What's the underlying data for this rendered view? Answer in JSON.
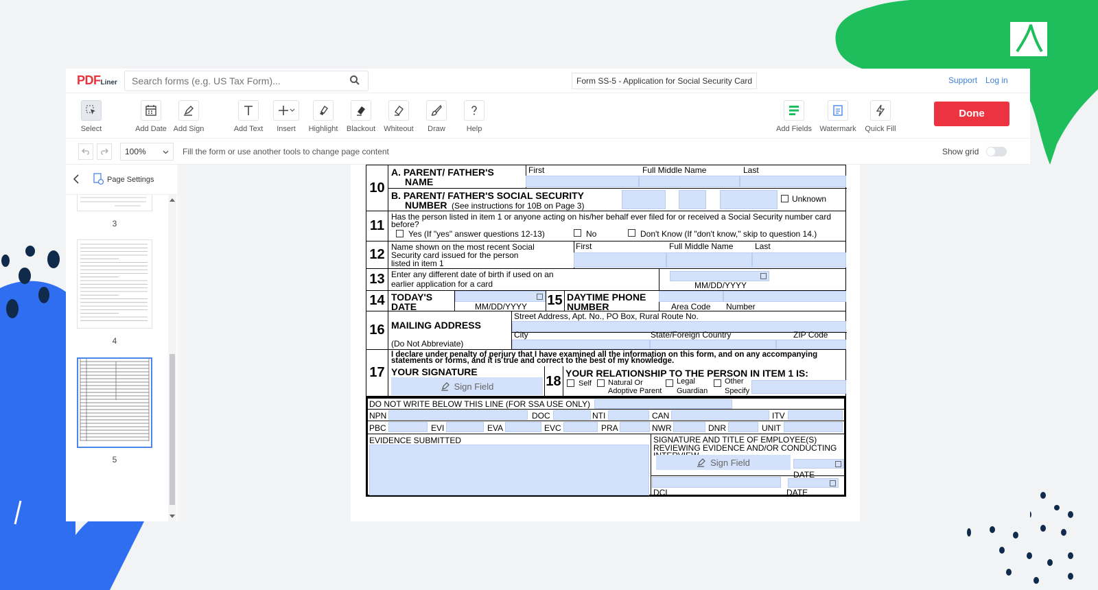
{
  "header": {
    "logo_main": "PDF",
    "logo_sub": "Liner",
    "search_placeholder": "Search forms (e.g. US Tax Form)...",
    "doc_title": "Form SS-5 - Application for Social Security Card",
    "support": "Support",
    "login": "Log in"
  },
  "toolbar": {
    "select": "Select",
    "add_date": "Add Date",
    "add_sign": "Add Sign",
    "add_text": "Add Text",
    "insert": "Insert",
    "highlight": "Highlight",
    "blackout": "Blackout",
    "whiteout": "Whiteout",
    "draw": "Draw",
    "help": "Help",
    "add_fields": "Add Fields",
    "watermark": "Watermark",
    "quick_fill": "Quick Fill",
    "done": "Done"
  },
  "subbar": {
    "zoom": "100%",
    "hint": "Fill the form or use another tools to change page content",
    "show_grid": "Show grid"
  },
  "sidebar": {
    "page_settings": "Page Settings",
    "pages": [
      "3",
      "4",
      "5"
    ]
  },
  "form": {
    "r10": {
      "num": "10",
      "a_label": "A. PARENT/ FATHER'S",
      "a_label2": "NAME",
      "first": "First",
      "middle": "Full Middle Name",
      "last": "Last",
      "b_label": "B. PARENT/ FATHER'S SOCIAL SECURITY",
      "b_label2": "NUMBER",
      "b_note": "(See instructions for 10B on Page 3)",
      "unknown": "Unknown"
    },
    "r11": {
      "num": "11",
      "q": "Has the person listed in item 1 or anyone acting on his/her behalf ever filed for or received a Social Security number card",
      "q2": "before?",
      "yes": "Yes (If \"yes\" answer questions 12-13)",
      "no": "No",
      "dk": "Don't Know (If \"don't know,\" skip to question 14.)"
    },
    "r12": {
      "num": "12",
      "l1": "Name shown on the most recent Social",
      "l2": "Security card issued for the person",
      "l3": "listed in item 1",
      "first": "First",
      "middle": "Full Middle Name",
      "last": "Last"
    },
    "r13": {
      "num": "13",
      "l1": "Enter any different date of birth if used on an",
      "l2": "earlier application for a card",
      "fmt": "MM/DD/YYYY"
    },
    "r14": {
      "num": "14",
      "l1": "TODAY'S",
      "l2": "DATE",
      "fmt": "MM/DD/YYYY",
      "num15": "15",
      "p1": "DAYTIME PHONE",
      "p2": "NUMBER",
      "area": "Area Code",
      "number": "Number"
    },
    "r16": {
      "num": "16",
      "l1": "MAILING ADDRESS",
      "l2": "(Do Not Abbreviate)",
      "street": "Street Address, Apt. No., PO Box, Rural Route No.",
      "city": "City",
      "state": "State/Foreign Country",
      "zip": "ZIP Code"
    },
    "r17": {
      "num": "17",
      "decl1": "I declare under penalty of perjury that I have examined all the information on this form, and on any accompanying",
      "decl2": "statements or forms, and it is true and correct to the best of my knowledge.",
      "sig": "YOUR SIGNATURE",
      "sign_field": "Sign Field",
      "num18": "18",
      "rel": "YOUR RELATIONSHIP TO THE PERSON IN ITEM 1 IS:",
      "self": "Self",
      "nat1": "Natural Or",
      "nat2": "Adoptive Parent",
      "leg1": "Legal",
      "leg2": "Guardian",
      "oth1": "Other",
      "oth2": "Specify"
    },
    "ssa": {
      "header": "DO NOT WRITE BELOW THIS LINE (FOR SSA USE ONLY)",
      "npn": "NPN",
      "doc": "DOC",
      "nti": "NTI",
      "can": "CAN",
      "itv": "ITV",
      "pbc": "PBC",
      "evi": "EVI",
      "eva": "EVA",
      "evc": "EVC",
      "pra": "PRA",
      "nwr": "NWR",
      "dnr": "DNR",
      "unit": "UNIT",
      "evidence": "EVIDENCE SUBMITTED",
      "sig1": "SIGNATURE AND TITLE OF EMPLOYEE(S)",
      "sig2": "REVIEWING EVIDENCE AND/OR CONDUCTING",
      "sig3": "INTERVIEW",
      "sign_field": "Sign Field",
      "date": "DATE",
      "dcl": "DCL",
      "date2": "DATE"
    }
  },
  "colors": {
    "accent_red": "#ec3340",
    "field_blue": "#d3e1fa",
    "deco_green": "#1ebe5d",
    "deco_blue": "#2f6ef0"
  }
}
